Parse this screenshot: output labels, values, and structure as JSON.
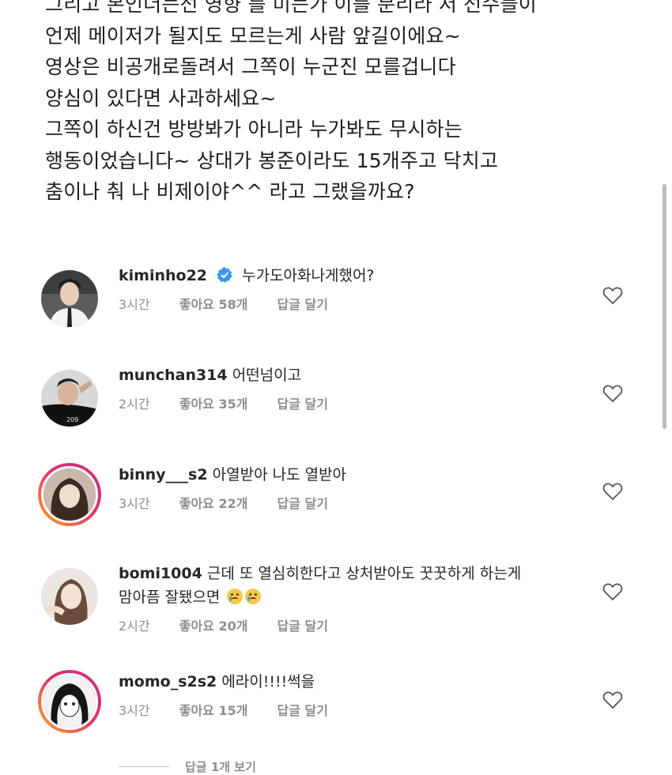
{
  "post": {
    "caption_lines": [
      "그리고 본인더는선 영향 를 미는가 이를 분리라 저 선수들이",
      "언제 메이저가 될지도 모르는게 사람 앞길이에요~",
      "영상은 비공개로돌려서 그쪽이 누군진 모를겁니다",
      "양심이 있다면 사과하세요~",
      "그쪽이 하신건 방방봐가 아니라 누가봐도 무시하는",
      "행동이었습니다~ 상대가 봉준이라도 15개주고 닥치고",
      "춤이나 춰 나 비제이야^^ 라고 그랬을까요?"
    ]
  },
  "comments": [
    {
      "username": "kiminho22",
      "verified": true,
      "text": "누가도아화나게했어?",
      "text2": "",
      "time": "3시간",
      "likes": "좋아요 58개",
      "reply": "답글 달기"
    },
    {
      "username": "munchan314",
      "verified": false,
      "text": "어떤넘이고",
      "text2": "",
      "time": "2시간",
      "likes": "좋아요 35개",
      "reply": "답글 달기"
    },
    {
      "username": "binny___s2",
      "verified": false,
      "text": "아열받아 나도 열받아",
      "text2": "",
      "time": "3시간",
      "likes": "좋아요 22개",
      "reply": "답글 달기"
    },
    {
      "username": "bomi1004",
      "verified": false,
      "text": "근데 또 열심히한다고 상처받아도 꿋꿋하게 하는게",
      "text2": "맘아픔 잘됐으면",
      "time": "2시간",
      "likes": "좋아요 20개",
      "reply": "답글 달기"
    },
    {
      "username": "momo_s2s2",
      "verified": false,
      "text": "에라이!!!!썩을",
      "text2": "",
      "time": "3시간",
      "likes": "좋아요 15개",
      "reply": "답글 달기"
    }
  ],
  "view_replies": "답글 1개 보기",
  "icons": {
    "verified": "verified-badge-icon",
    "like": "heart-outline-icon",
    "emoji": "crying-face-icon"
  },
  "colors": {
    "verified": "#3897f0",
    "meta": "#8e8e8e",
    "story_ring": "#e1306c"
  }
}
